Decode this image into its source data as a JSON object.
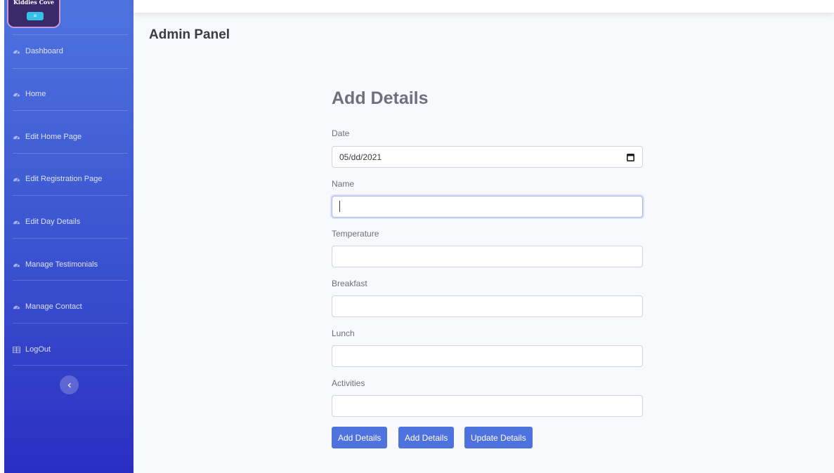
{
  "sidebar": {
    "logo_text": "Kiddies Cove",
    "items": [
      {
        "label": "Dashboard",
        "icon": "dashboard-icon"
      },
      {
        "label": "Home",
        "icon": "dashboard-icon"
      },
      {
        "label": "Edit Home Page",
        "icon": "dashboard-icon"
      },
      {
        "label": "Edit Registration Page",
        "icon": "dashboard-icon"
      },
      {
        "label": "Edit Day Details",
        "icon": "dashboard-icon"
      },
      {
        "label": "Manage Testimonials",
        "icon": "dashboard-icon"
      },
      {
        "label": "Manage Contact",
        "icon": "dashboard-icon"
      },
      {
        "label": "LogOut",
        "icon": "table-icon"
      }
    ],
    "toggle_icon": "chevron-left-icon"
  },
  "header": {
    "title": "Admin Panel"
  },
  "form": {
    "title": "Add Details",
    "date": {
      "label": "Date",
      "value": "05/dd/2021",
      "icon": "calendar-icon"
    },
    "name": {
      "label": "Name",
      "value": ""
    },
    "temperature": {
      "label": "Temperature",
      "value": ""
    },
    "breakfast": {
      "label": "Breakfast",
      "value": ""
    },
    "lunch": {
      "label": "Lunch",
      "value": ""
    },
    "activities": {
      "label": "Activities",
      "value": ""
    },
    "buttons": {
      "add_1": "Add Details",
      "add_2": "Add Details",
      "update": "Update Details"
    }
  },
  "colors": {
    "primary": "#4e73df",
    "sidebar_top": "#4e73df",
    "sidebar_bottom": "#2a2ec2",
    "page_bg": "#f8f9fc"
  }
}
